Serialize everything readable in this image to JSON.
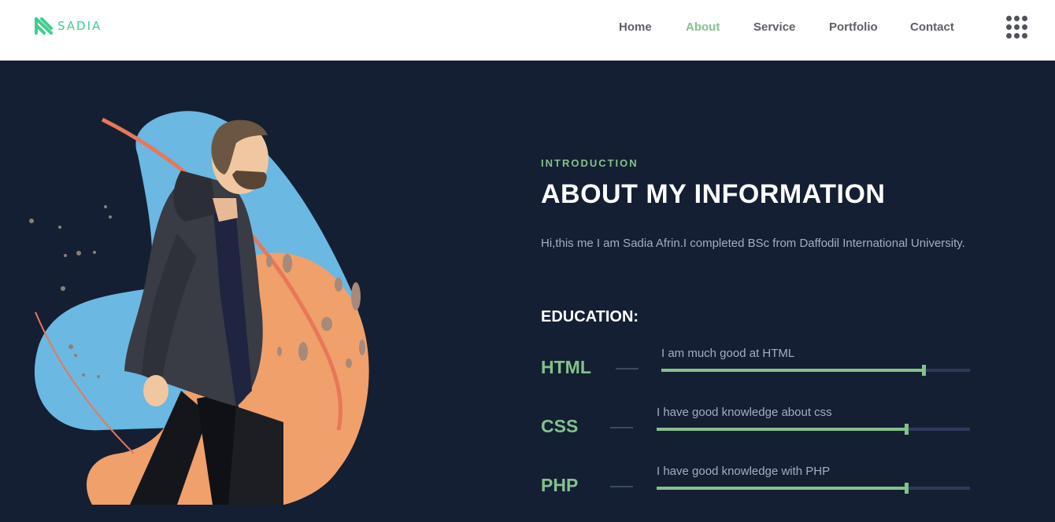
{
  "brand": {
    "name": "SADIA"
  },
  "nav": {
    "items": [
      {
        "label": "Home"
      },
      {
        "label": "About"
      },
      {
        "label": "Service"
      },
      {
        "label": "Portfolio"
      },
      {
        "label": "Contact"
      }
    ],
    "active": "About",
    "menu_icon": "grid-dots-icon"
  },
  "about": {
    "eyebrow": "INTRODUCTION",
    "title": "ABOUT MY INFORMATION",
    "intro": "Hi,this me I am Sadia Afrin.I completed BSc from Daffodil International University.",
    "education_title": "EDUCATION:"
  },
  "skills": [
    {
      "name": "HTML",
      "desc": "I am much good at HTML",
      "level": 0.85
    },
    {
      "name": "CSS",
      "desc": "I have  good knowledge about  css",
      "level": 0.797
    },
    {
      "name": "PHP",
      "desc": "I have good knowledge with PHP",
      "level": 0.797
    }
  ],
  "colors": {
    "accent": "#84c18b",
    "background": "#141f33",
    "text_muted": "#a5adc4",
    "logo": "#3ecf8e",
    "track": "#30395a"
  }
}
